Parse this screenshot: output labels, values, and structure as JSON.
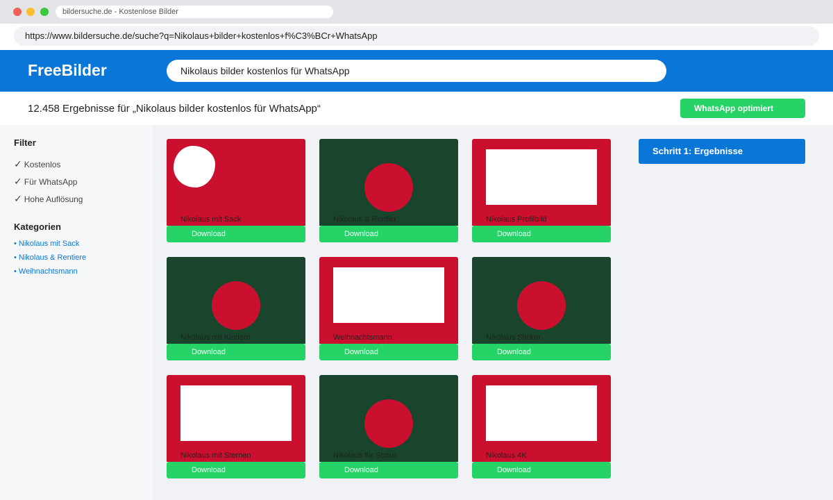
{
  "browser": {
    "tab_title": "bildersuche.de - Kostenlose Bilder",
    "url": "https://www.bildersuche.de/suche?q=Nikolaus+bilder+kostenlos+f%C3%BCr+WhatsApp",
    "traffic_colors": [
      "#f25f58",
      "#fbbe2e",
      "#39c840"
    ]
  },
  "header": {
    "logo": "FreeBilder",
    "search_value": "Nikolaus bilder kostenlos für WhatsApp",
    "brand_color": "#0a77d8"
  },
  "results": {
    "count_text": "12.458 Ergebnisse für „Nikolaus bilder kostenlos für WhatsApp“",
    "badge": "WhatsApp optimiert",
    "accent_color": "#25d366"
  },
  "sidebar": {
    "filter_title": "Filter",
    "check_glyph": "✓",
    "filters": [
      "Kostenlos",
      "Für WhatsApp",
      "Hohe Auflösung"
    ],
    "categories_title": "Kategorien",
    "categories": [
      "• Nikolaus mit Sack",
      "• Nikolaus & Rentiere",
      "• Weihnachtsmann"
    ]
  },
  "grid": {
    "download_label": "Download",
    "cards": [
      {
        "caption": "Nikolaus mit Sack",
        "bg": "red",
        "shape": "blob"
      },
      {
        "caption": "Nikolaus & Rentier",
        "bg": "green",
        "shape": "circle"
      },
      {
        "caption": "Nikolaus Profilbild",
        "bg": "red",
        "shape": "rect"
      },
      {
        "caption": "Nikolaus mit Kindern",
        "bg": "green",
        "shape": "circle"
      },
      {
        "caption": "Weihnachtsmann",
        "bg": "red",
        "shape": "rect"
      },
      {
        "caption": "Nikolaus Sticker",
        "bg": "green",
        "shape": "circle"
      },
      {
        "caption": "Nikolaus mit Sternen",
        "bg": "red",
        "shape": "rect"
      },
      {
        "caption": "Nikolaus für Status",
        "bg": "green",
        "shape": "circle"
      },
      {
        "caption": "Nikolaus 4K",
        "bg": "red",
        "shape": "rect"
      }
    ]
  },
  "step": {
    "label": "Schritt 1: Ergebnisse"
  }
}
